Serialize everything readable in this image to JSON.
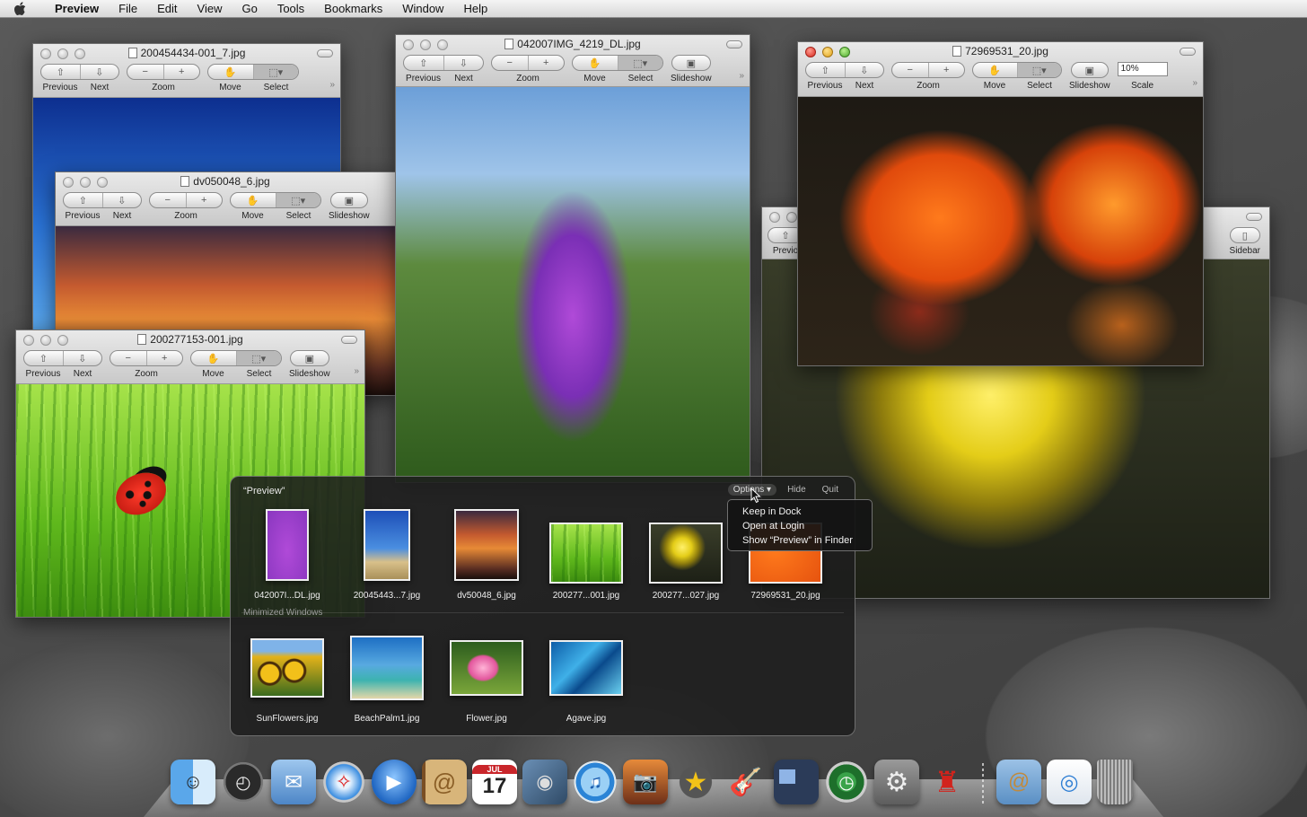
{
  "menubar": {
    "app": "Preview",
    "items": [
      "File",
      "Edit",
      "View",
      "Go",
      "Tools",
      "Bookmarks",
      "Window",
      "Help"
    ]
  },
  "toolbar_labels": {
    "previous": "Previous",
    "next": "Next",
    "zoom": "Zoom",
    "move": "Move",
    "select": "Select",
    "slideshow": "Slideshow",
    "scale": "Scale",
    "sidebar": "Sidebar"
  },
  "windows": {
    "w1": {
      "title": "200454434-001_7.jpg"
    },
    "w2": {
      "title": "dv050048_6.jpg"
    },
    "w3": {
      "title": "200277153-001.jpg"
    },
    "w4": {
      "title": "042007IMG_4219_DL.jpg"
    },
    "w5": {
      "title": "72969531_20.jpg",
      "scale_value": "10%"
    },
    "w6": {
      "prev_partial": "Previo"
    }
  },
  "panel": {
    "title": "“Preview”",
    "options": "Options",
    "hide": "Hide",
    "quit": "Quit",
    "thumbnails": [
      "042007I...DL.jpg",
      "20045443...7.jpg",
      "dv50048_6.jpg",
      "200277...001.jpg",
      "200277...027.jpg",
      "72969531_20.jpg"
    ],
    "minimized_label": "Minimized Windows",
    "minimized": [
      "SunFlowers.jpg",
      "BeachPalm1.jpg",
      "Flower.jpg",
      "Agave.jpg"
    ]
  },
  "options_menu": {
    "items": [
      "Keep in Dock",
      "Open at Login",
      "Show “Preview” in Finder"
    ]
  },
  "dock": {
    "calendar_month": "JUL",
    "calendar_day": "17"
  }
}
